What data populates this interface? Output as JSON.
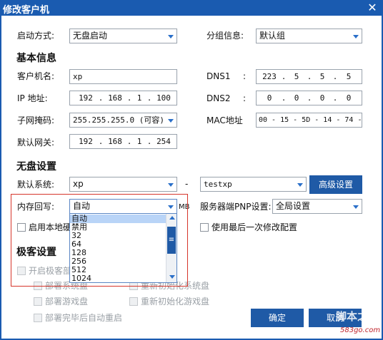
{
  "window": {
    "title": "修改客户机",
    "close_glyph": "✕"
  },
  "top": {
    "boot_label": "启动方式:",
    "boot_value": "无盘启动",
    "group_label": "分组信息:",
    "group_value": "默认组"
  },
  "basic": {
    "header": "基本信息",
    "name_label": "客户机名:",
    "name_value": "xp",
    "ip_label": "IP  地址:",
    "ip_octets": [
      "192",
      "168",
      "1",
      "100"
    ],
    "mask_label": "子网掩码:",
    "mask_value": "255.255.255.0  (可容)",
    "gw_label": "默认网关:",
    "gw_octets": [
      "192",
      "168",
      "1",
      "254"
    ],
    "dns1_label": "DNS1",
    "dns1_octets": [
      "223",
      "5",
      "5",
      "5"
    ],
    "dns2_label": "DNS2",
    "dns2_octets": [
      "0",
      "0",
      "0",
      "0"
    ],
    "mac_label": "MAC地址",
    "mac_value": "00 - 15 - 5D - 14 - 74 - 06",
    "colon": ":",
    "dot": "."
  },
  "diskless": {
    "header": "无盘设置",
    "sys_label": "默认系统:",
    "sys_value": "xp",
    "dash": "-",
    "sys2_value": "testxp",
    "adv_button": "高级设置",
    "cache_label": "内存回写:",
    "cache_value": "自动",
    "cache_unit": "MB",
    "pnp_label": "服务器端PNP设置:",
    "pnp_value": "全局设置",
    "local_disk_label": "启用本地硬",
    "local_disk_tail": "禁用",
    "last_config_label": "使用最后一次修改配置"
  },
  "dropdown": {
    "options": [
      "自动",
      "禁用",
      "32",
      "64",
      "128",
      "256",
      "512",
      "1024"
    ],
    "selected": 0,
    "thumb_glyph": "≡"
  },
  "geek": {
    "header": "极客设置",
    "enable_label": "开启极客部",
    "opt1": "部署系统盘",
    "opt2": "重新初始化系统盘",
    "opt3": "部署游戏盘",
    "opt4": "重新初始化游戏盘",
    "opt5": "部署完毕后自动重启"
  },
  "buttons": {
    "ok": "确定",
    "cancel": "取消"
  },
  "watermark": {
    "text1": "脚本之家",
    "text2": "583go.com"
  },
  "colors": {
    "accent": "#1a5bb0",
    "button": "#1f5aa6",
    "highlight": "#b9d4f7",
    "red_box": "#d6352b"
  }
}
